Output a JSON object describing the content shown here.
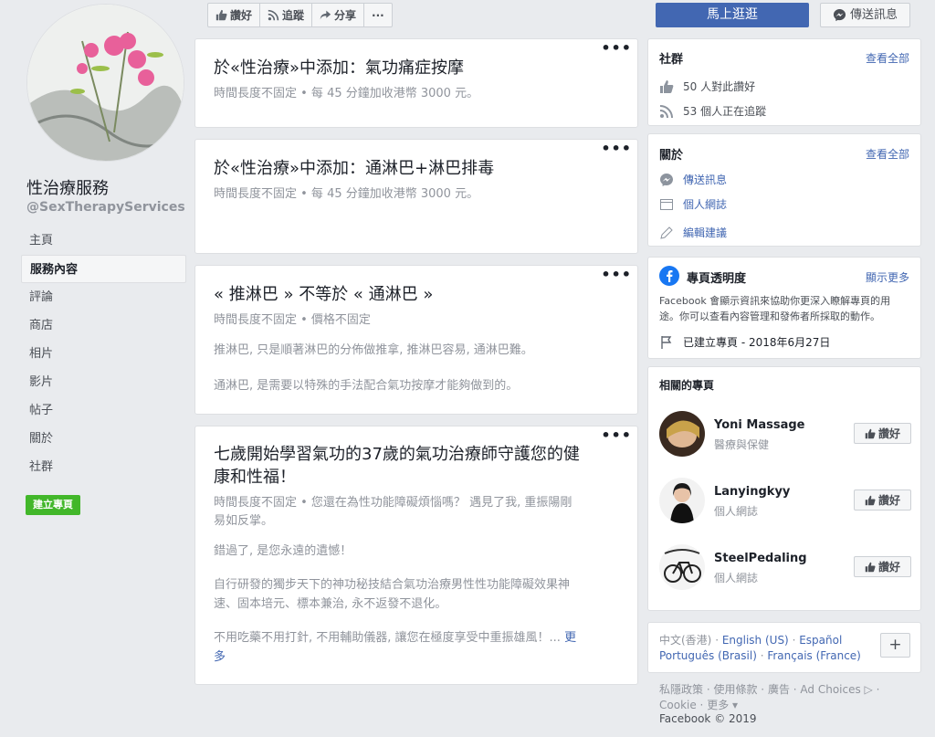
{
  "page": {
    "name": "性治療服務",
    "handle": "@SexTherapyServices"
  },
  "nav": {
    "items": [
      "主頁",
      "服務內容",
      "評論",
      "商店",
      "相片",
      "影片",
      "帖子",
      "關於",
      "社群"
    ],
    "create_page": "建立專頁"
  },
  "actions": {
    "like": "讚好",
    "follow": "追蹤",
    "share": "分享",
    "more": "···",
    "shop_now": "馬上逛逛",
    "send_message": "傳送訊息"
  },
  "services": [
    {
      "title": "於«性治療»中添加：氣功痛症按摩",
      "meta": "時間長度不固定 • 每 45 分鐘加收港幣 3000 元。"
    },
    {
      "title": "於«性治療»中添加：通淋巴+淋巴排毒",
      "meta": "時間長度不固定 • 每 45 分鐘加收港幣 3000 元。"
    },
    {
      "title": "« 推淋巴 » 不等於 « 通淋巴 »",
      "meta": "時間長度不固定 • 價格不固定",
      "para1": "推淋巴, 只是順著淋巴的分佈做推拿, 推淋巴容易, 通淋巴難。",
      "para2": "通淋巴, 是需要以特殊的手法配合氣功按摩才能夠做到的。"
    },
    {
      "title_line1": "七歲開始學習氣功的37歲的氣功治療師守護您的健",
      "title_line2": "康和性福！",
      "meta_line1": "時間長度不固定 • 您還在為性功能障礙煩惱嗎？ 遇見了我, 重振陽剛",
      "meta_line2": "易如反掌。",
      "para1": "錯過了, 是您永遠的遺憾！",
      "para2_line1": "自行研發的獨步天下的神功秘技結合氣功治療男性性功能障礙效果神",
      "para2_line2": "速、固本培元、標本兼治, 永不返發不退化。",
      "para3_line1": "不用吃藥不用打針, 不用輔助儀器, 讓您在極度享受中重振雄風！...",
      "more_link_a": "更",
      "more_link_b": "多"
    }
  ],
  "community": {
    "title": "社群",
    "see_all": "查看全部",
    "likes": "50 人對此讚好",
    "follows": "53 個人正在追蹤"
  },
  "about": {
    "title": "關於",
    "see_all": "查看全部",
    "message": "傳送訊息",
    "category": "個人網誌",
    "suggest": "編輯建議"
  },
  "transparency": {
    "title": "專頁透明度",
    "see_more": "顯示更多",
    "text_line1": "Facebook 會顯示資訊來協助你更深入瞭解專頁的用",
    "text_line2": "途。你可以查看內容管理和發佈者所採取的動作。",
    "created": "已建立專頁 - 2018年6月27日"
  },
  "related": {
    "title": "相關的專頁",
    "pages": [
      {
        "name": "Yoni Massage",
        "category": "醫療與保健",
        "like": "讚好"
      },
      {
        "name": "Lanyingkyy",
        "category": "個人網誌",
        "like": "讚好"
      },
      {
        "name": "SteelPedaling",
        "category": "個人網誌",
        "like": "讚好"
      }
    ]
  },
  "languages": {
    "current": "中文(香港)",
    "options": [
      "English (US)",
      "Español",
      "Português (Brasil)",
      "Français (France)"
    ],
    "plus": "+"
  },
  "footer": {
    "links": [
      "私隱政策",
      "使用條款",
      "廣告",
      "Ad Choices",
      "Cookie",
      "更多"
    ],
    "copyright": "Facebook © 2019"
  },
  "colors": {
    "accent": "#4267b2",
    "create_button": "#42b72a",
    "background": "#e9ebee"
  }
}
